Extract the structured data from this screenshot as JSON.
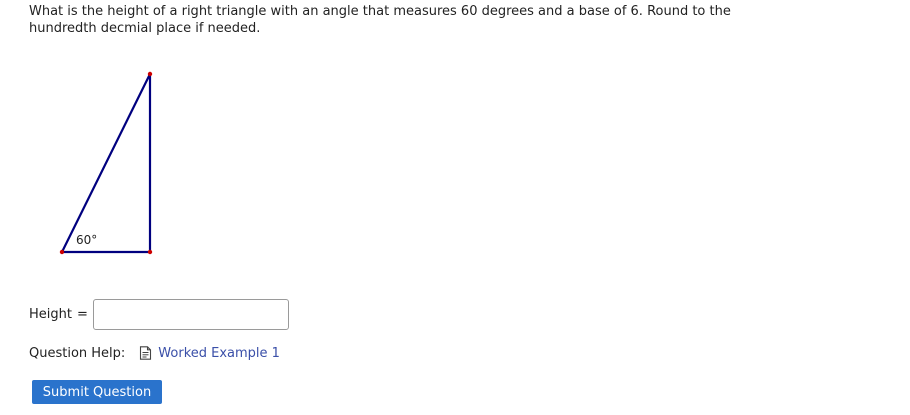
{
  "question": {
    "text": "What is the height of a right triangle with an angle that measures 60 degrees and a base of 6. Round to the hundredth decmial place if needed."
  },
  "figure": {
    "angle_label": "60°",
    "line_color": "#00007f",
    "vertex_color": "#cc0000"
  },
  "answer": {
    "label": "Height",
    "equals": "=",
    "value": "",
    "placeholder": ""
  },
  "help": {
    "label": "Question Help:",
    "link_label": "Worked Example 1",
    "link_icon": "document-icon"
  },
  "submit": {
    "label": "Submit Question",
    "color": "#2a73cc"
  }
}
